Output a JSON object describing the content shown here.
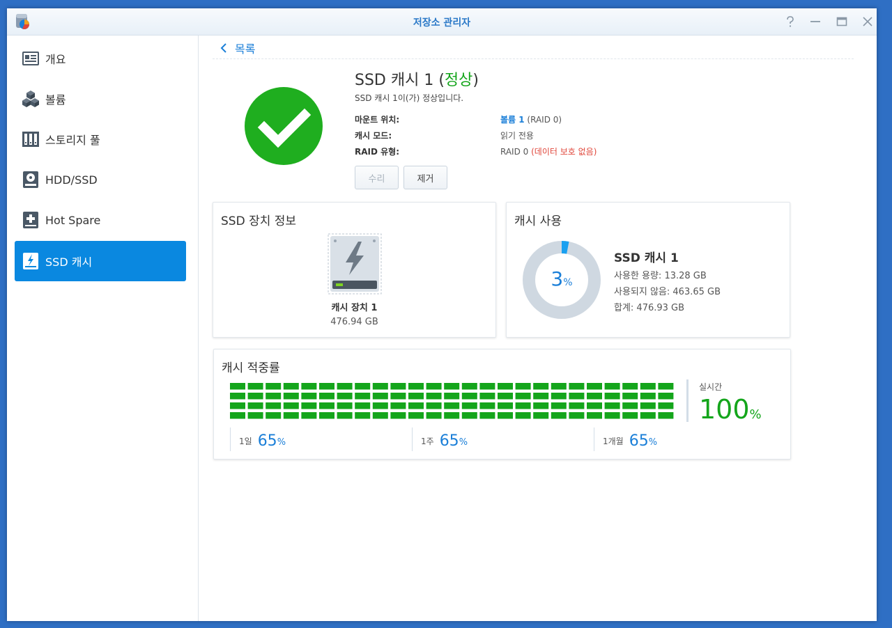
{
  "window": {
    "title": "저장소 관리자",
    "icon": "storage-manager-app-icon",
    "controls": [
      "help-icon",
      "minimize-icon",
      "maximize-icon",
      "close-icon"
    ]
  },
  "sidebar": {
    "items": [
      {
        "label": "개요",
        "icon": "overview-icon",
        "active": false
      },
      {
        "label": "볼륨",
        "icon": "volume-cubes-icon",
        "active": false
      },
      {
        "label": "스토리지 풀",
        "icon": "storage-pool-icon",
        "active": false
      },
      {
        "label": "HDD/SSD",
        "icon": "hdd-icon",
        "active": false
      },
      {
        "label": "Hot Spare",
        "icon": "hot-spare-icon",
        "active": false
      },
      {
        "label": "SSD 캐시",
        "icon": "ssd-cache-icon",
        "active": true
      }
    ]
  },
  "back": {
    "label": "목록"
  },
  "header": {
    "title_prefix": "SSD 캐시 1 (",
    "status": "정상",
    "title_suffix": ")",
    "subtitle": "SSD 캐시 1이(가) 정상입니다.",
    "status_color": "#14a51b"
  },
  "details": {
    "mount_key": "마운트 위치:",
    "mount_link": "볼륨 1",
    "mount_extra": " (RAID 0)",
    "mode_key": "캐시 모드:",
    "mode_val": "읽기 전용",
    "raid_key": "RAID 유형:",
    "raid_val": "RAID 0 ",
    "raid_warn": "(데이터 보호 없음)"
  },
  "buttons": {
    "repair": "수리",
    "remove": "제거"
  },
  "device_card": {
    "title": "SSD 장치 정보",
    "device_name": "캐시 장치 1",
    "device_size": "476.94 GB",
    "icon": "ssd-device-icon"
  },
  "usage_card": {
    "title": "캐시 사용",
    "percent": 3,
    "unit": "%",
    "name": "SSD 캐시 1",
    "used": "사용한 용량: 13.28 GB",
    "unused": "사용되지 않음: 463.65 GB",
    "total": "합계: 476.93 GB",
    "used_color": "#1aa0f0",
    "free_color": "#cfd8e1"
  },
  "hit_card": {
    "title": "캐시 적중률",
    "realtime_label": "실시간",
    "realtime_value": "100",
    "unit": "%",
    "realtime_fill": 1.0,
    "bar_color": "#14a51b",
    "periods": [
      {
        "label": "1일",
        "value": "65"
      },
      {
        "label": "1주",
        "value": "65"
      },
      {
        "label": "1개월",
        "value": "65"
      }
    ]
  }
}
